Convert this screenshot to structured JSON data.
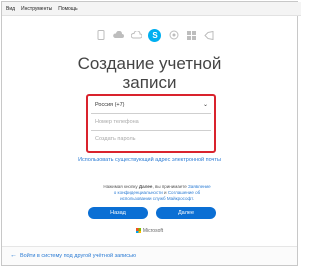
{
  "menubar": {
    "items": [
      "Вид",
      "Инструменты",
      "Помощь"
    ]
  },
  "apps": {
    "icons": [
      "phone-icon",
      "cloud-icon",
      "cloud-outline-icon",
      "skype-icon",
      "outlook-icon",
      "windows-icon",
      "vs-icon"
    ],
    "active_glyph": "S"
  },
  "page": {
    "title_line1": "Создание учетной",
    "title_line2": "записи"
  },
  "form": {
    "country": "Россия (+7)",
    "phone_placeholder": "Номер телефона",
    "password_placeholder": "Создать пароль"
  },
  "links": {
    "use_email": "Использовать существующий адрес электронной почты"
  },
  "legal": {
    "prefix": "Нажимая кнопку",
    "button_ref": "Далее",
    "middle": ", вы принимаете",
    "link1": "Заявление о конфиденциальности",
    "and": "и",
    "link2": "Соглашение об использовании служб Майкрософт."
  },
  "buttons": {
    "back": "Назад",
    "next": "Далее"
  },
  "footer": {
    "brand": "Microsoft",
    "signin_other": "Войти в систему под другой учётной записью"
  }
}
